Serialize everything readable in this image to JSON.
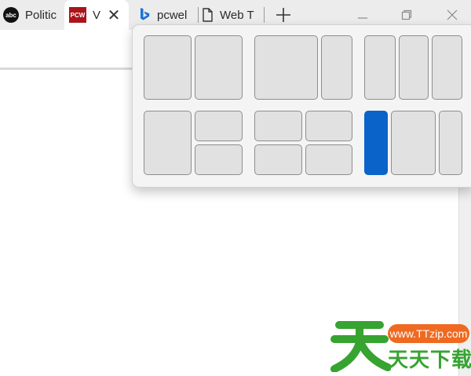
{
  "tabs": [
    {
      "title": "Politic",
      "favicon": "abc-news-logo-icon"
    },
    {
      "title": "V",
      "favicon": "pcworld-logo-icon",
      "favicon_text": "PCW",
      "active": true,
      "close": "✕"
    },
    {
      "title": "pcwel",
      "favicon": "bing-logo-icon"
    },
    {
      "title": "Web T",
      "favicon": "page-icon"
    }
  ],
  "snap_layouts": {
    "groups": [
      {
        "layout": "two-equal-columns",
        "zones": 2
      },
      {
        "layout": "wide-left-narrow-right",
        "zones": 2
      },
      {
        "layout": "three-columns",
        "zones": 3
      },
      {
        "layout": "left-column-right-stacked",
        "zones": 3
      },
      {
        "layout": "four-quadrants",
        "zones": 4
      },
      {
        "layout": "narrow-wide-narrow",
        "zones": 3,
        "selected_zone": 1
      }
    ],
    "selected_color": "#0a63c9"
  },
  "watermark": {
    "logo": "天",
    "site": "www.TTzip.com",
    "name": "天天下载",
    "green": "#37a331",
    "orange": "#ef6a20"
  }
}
